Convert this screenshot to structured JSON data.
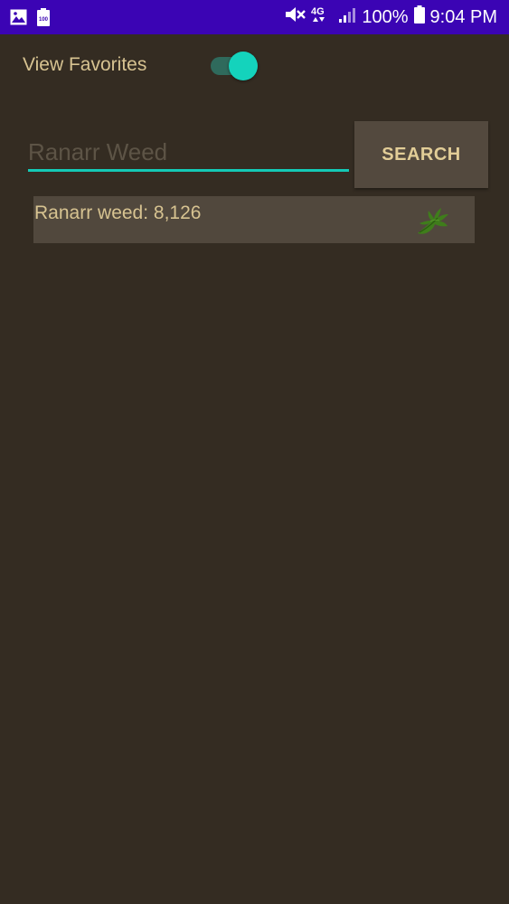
{
  "status_bar": {
    "battery_percent": "100%",
    "time": "9:04 PM",
    "network": "4G",
    "battery_badge": "100",
    "icons_left": [
      "image-icon",
      "battery-saver-icon"
    ],
    "icons_right": [
      "mute-icon",
      "4g-lte-icon",
      "signal-icon",
      "battery-icon"
    ]
  },
  "favorites_toggle": {
    "label": "View Favorites",
    "on": true
  },
  "search": {
    "placeholder": "Ranarr Weed",
    "value": "",
    "button_label": "SEARCH"
  },
  "results": [
    {
      "text": "Ranarr weed: 8,126",
      "icon": "herb-leaf-icon"
    }
  ],
  "colors": {
    "status_bar": "#3b04b4",
    "background": "#342c22",
    "text": "#d7c391",
    "accent": "#14d3bc",
    "button": "#53493e",
    "result_bg": "#51483d"
  }
}
